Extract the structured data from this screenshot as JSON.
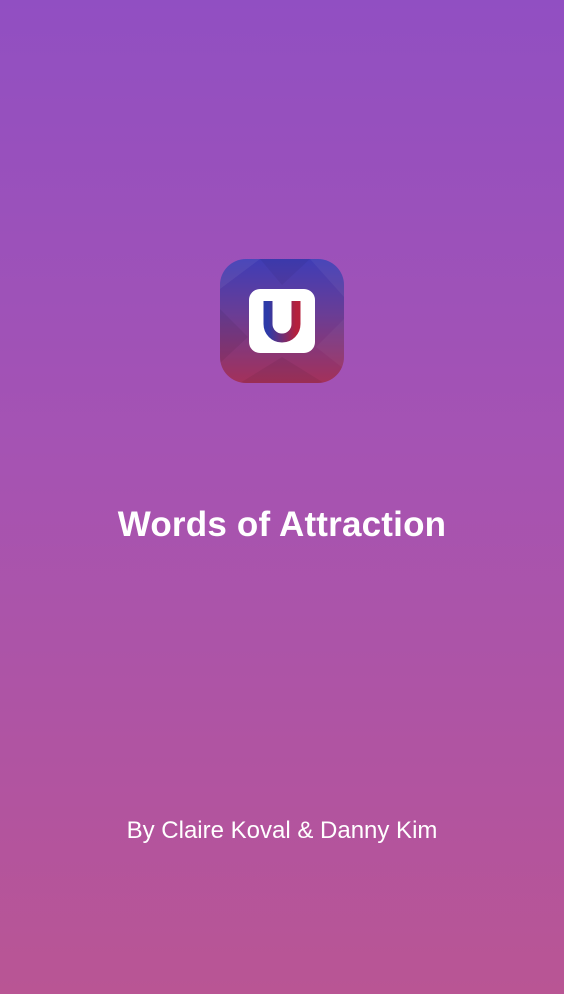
{
  "app": {
    "icon": "u-magnet-icon",
    "title": "Words of Attraction",
    "credits": "By Claire Koval & Danny Kim"
  },
  "colors": {
    "background_top": "#914fc2",
    "background_bottom": "#b95594",
    "icon_top": "#3f3db6",
    "icon_bottom": "#a4315a",
    "letter_blue": "#2d3aa8",
    "letter_red": "#b5203d",
    "text": "#ffffff"
  }
}
